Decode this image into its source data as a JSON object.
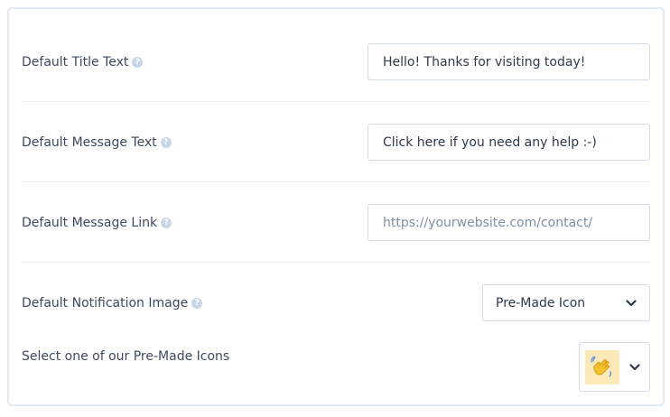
{
  "fields": {
    "title": {
      "label": "Default Title Text",
      "value": "Hello! Thanks for visiting today!"
    },
    "message": {
      "label": "Default Message Text",
      "value": "Click here if you need any help :-)"
    },
    "link": {
      "label": "Default Message Link",
      "placeholder": "https://yourwebsite.com/contact/"
    },
    "image": {
      "label": "Default Notification Image",
      "selected": "Pre-Made Icon"
    },
    "premade": {
      "label": "Select one of our Pre-Made Icons",
      "selected_icon": "waving-hand-icon"
    }
  },
  "help_glyph": "?",
  "colors": {
    "border": "#e3e9f0",
    "label": "#3b4a5f",
    "help_icon": "#c8d6e6",
    "icon_background": "#fbe9b8"
  }
}
